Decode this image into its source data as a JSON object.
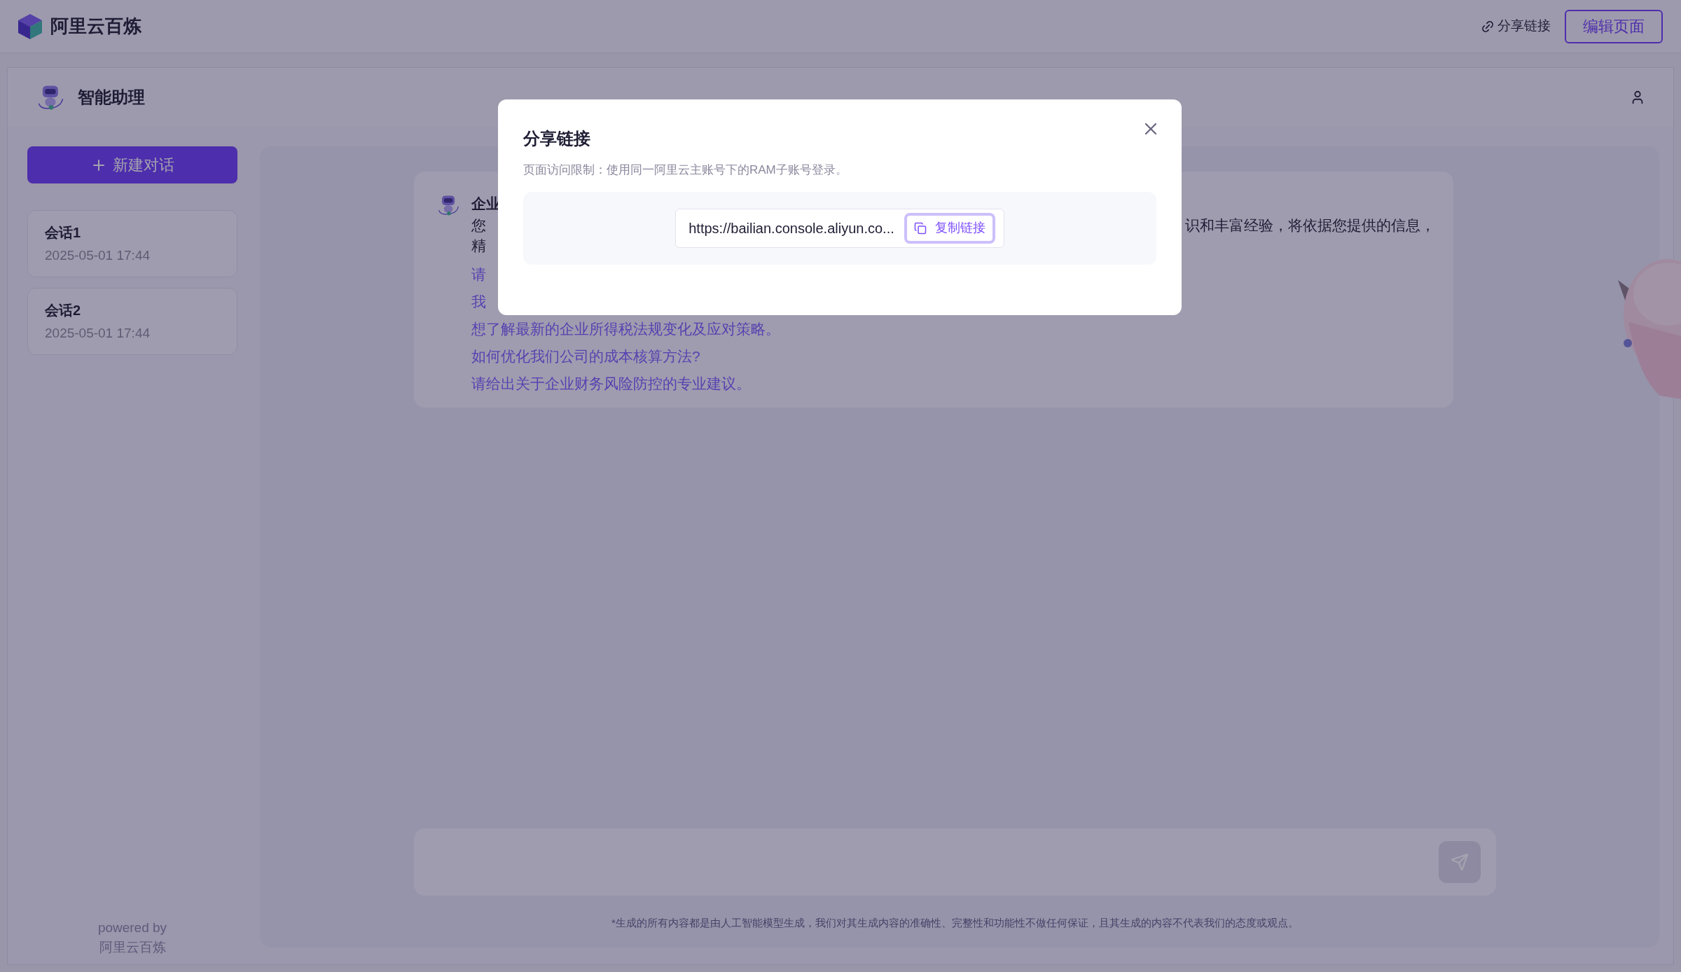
{
  "header": {
    "brand": "阿里云百炼",
    "share_link": "分享链接",
    "edit_button": "编辑页面"
  },
  "app": {
    "title": "智能助理"
  },
  "sidebar": {
    "new_chat": "新建对话",
    "sessions": [
      {
        "name": "会话1",
        "time": "2025-05-01 17:44"
      },
      {
        "name": "会话2",
        "time": "2025-05-01 17:44"
      }
    ],
    "powered_by": "powered by",
    "powered_brand": "阿里云百炼"
  },
  "message": {
    "title": "企业",
    "line_2_start": "您",
    "line_2_end": "识和丰富经验，将依据您提供的信息，",
    "line_3": "精",
    "suggestions": [
      "请",
      "我",
      "想了解最新的企业所得税法规变化及应对策略。",
      "如何优化我们公司的成本核算方法?",
      "请给出关于企业财务风险防控的专业建议。"
    ]
  },
  "disclaimer": "*生成的所有内容都是由人工智能模型生成，我们对其生成内容的准确性、完整性和功能性不做任何保证，且其生成的内容不代表我们的态度或观点。",
  "dialog": {
    "title": "分享链接",
    "note": "页面访问限制：使用同一阿里云主账号下的RAM子账号登录。",
    "url": "https://bailian.console.aliyun.co...",
    "copy_button": "复制链接"
  }
}
